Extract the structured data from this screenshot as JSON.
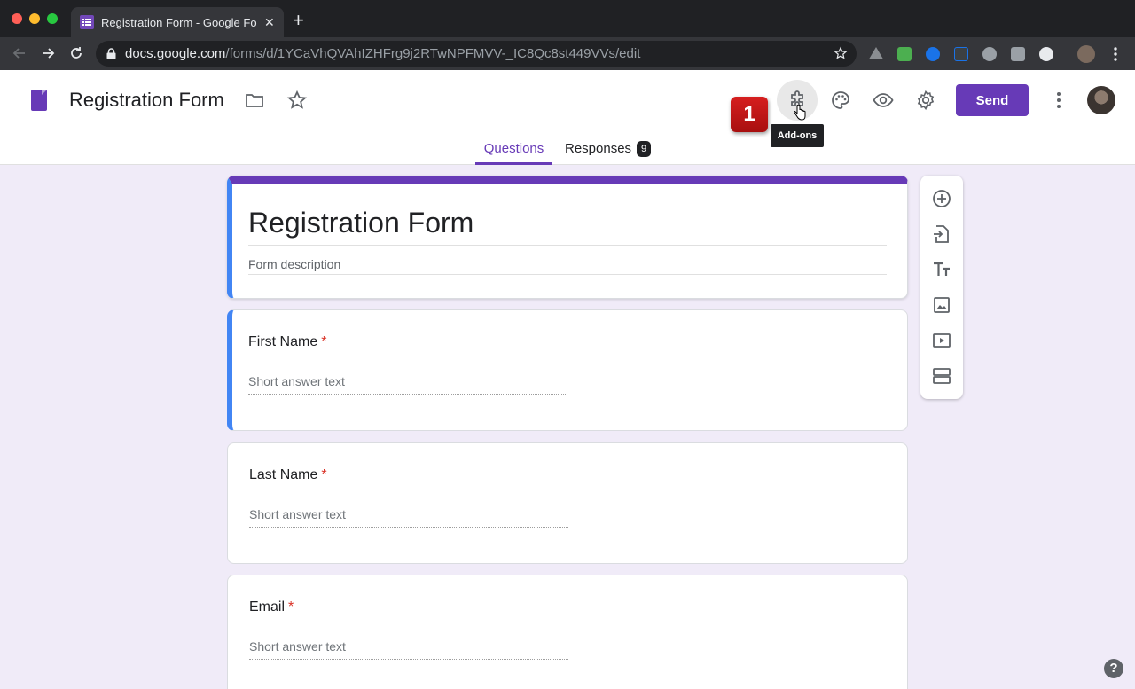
{
  "browser": {
    "tab_title": "Registration Form - Google Forms",
    "new_tab": "+",
    "close": "✕",
    "url_host": "docs.google.com",
    "url_path": "/forms/d/1YCaVhQVAhIZHFrg9j2RTwNPFMVV-_IC8Qc8st449VVs/edit"
  },
  "header": {
    "doc_title": "Registration Form",
    "send_label": "Send",
    "tooltip": "Add-ons",
    "step_badge": "1"
  },
  "tabs": {
    "questions": "Questions",
    "responses": "Responses",
    "responses_count": "9"
  },
  "form": {
    "title": "Registration Form",
    "description_placeholder": "Form description",
    "questions": [
      {
        "label": "First Name",
        "required": "*",
        "placeholder": "Short answer text"
      },
      {
        "label": "Last Name",
        "required": "*",
        "placeholder": "Short answer text"
      },
      {
        "label": "Email",
        "required": "*",
        "placeholder": "Short answer text"
      }
    ]
  },
  "help": "?",
  "colors": {
    "accent": "#673ab7",
    "focus": "#4285f4",
    "required": "#d93025",
    "background": "#f0ebf8"
  }
}
